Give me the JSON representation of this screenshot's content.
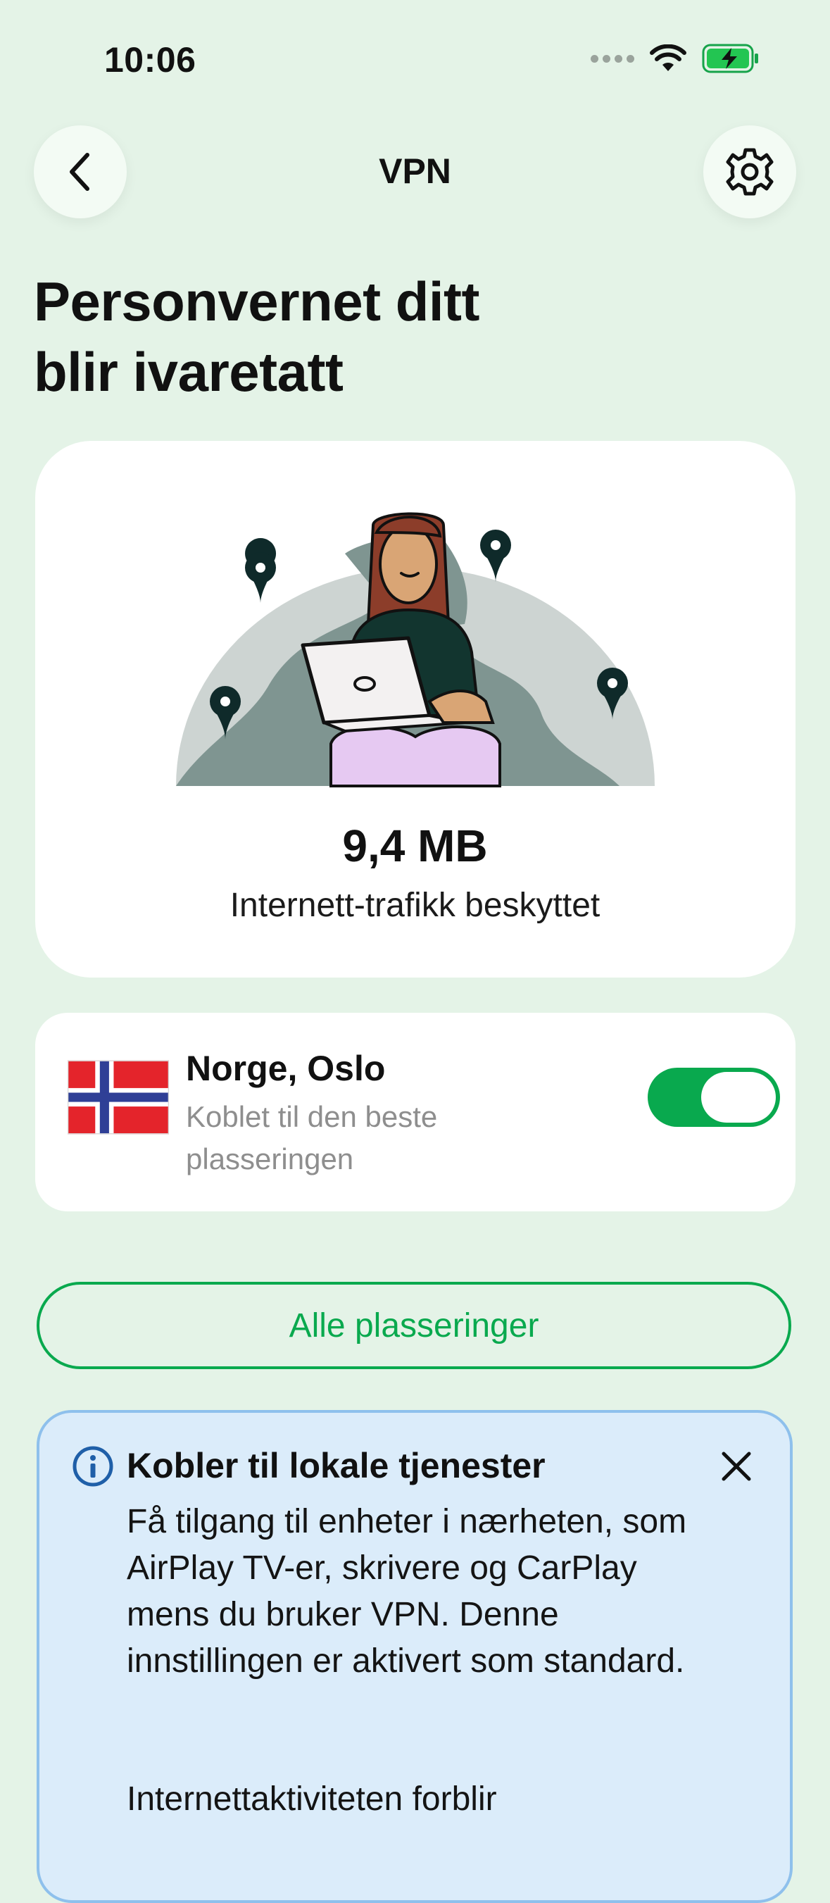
{
  "status_bar": {
    "time": "10:06"
  },
  "nav": {
    "title": "VPN"
  },
  "headline": {
    "line1": "Personvernet ditt",
    "line2": "blir ivaretatt"
  },
  "hero": {
    "traffic_value": "9,4 MB",
    "traffic_label": "Internett-trafikk beskyttet"
  },
  "location": {
    "title": "Norge, Oslo",
    "subtitle": "Koblet til den beste plasseringen",
    "flag_icon": "norway-flag-icon",
    "vpn_enabled": true
  },
  "all_locations_button": "Alle plasseringer",
  "info": {
    "title": "Kobler til lokale tjenester",
    "body": "Få tilgang til enheter i nærheten, som AirPlay TV-er, skrivere og CarPlay mens du bruker VPN. Denne innstillingen er aktivert som standard.",
    "body2": "Internettaktiviteten forblir"
  },
  "colors": {
    "background": "#e4f3e7",
    "accent_green": "#09a94e",
    "info_background": "#dbecfa",
    "info_border": "#8ec0ec"
  }
}
